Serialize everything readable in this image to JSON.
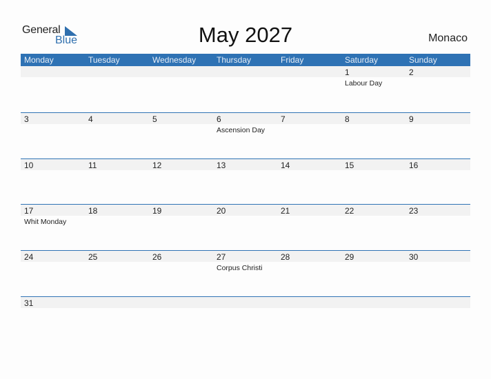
{
  "logo": {
    "general": "General",
    "blue": "Blue"
  },
  "title": "May 2027",
  "country": "Monaco",
  "colors": {
    "accent": "#2e72b4",
    "band": "#f2f2f2"
  },
  "weekdays": [
    "Monday",
    "Tuesday",
    "Wednesday",
    "Thursday",
    "Friday",
    "Saturday",
    "Sunday"
  ],
  "weeks": [
    [
      {
        "day": ""
      },
      {
        "day": ""
      },
      {
        "day": ""
      },
      {
        "day": ""
      },
      {
        "day": ""
      },
      {
        "day": "1",
        "holiday": "Labour Day"
      },
      {
        "day": "2"
      }
    ],
    [
      {
        "day": "3"
      },
      {
        "day": "4"
      },
      {
        "day": "5"
      },
      {
        "day": "6",
        "holiday": "Ascension Day"
      },
      {
        "day": "7"
      },
      {
        "day": "8"
      },
      {
        "day": "9"
      }
    ],
    [
      {
        "day": "10"
      },
      {
        "day": "11"
      },
      {
        "day": "12"
      },
      {
        "day": "13"
      },
      {
        "day": "14"
      },
      {
        "day": "15"
      },
      {
        "day": "16"
      }
    ],
    [
      {
        "day": "17",
        "holiday": "Whit Monday"
      },
      {
        "day": "18"
      },
      {
        "day": "19"
      },
      {
        "day": "20"
      },
      {
        "day": "21"
      },
      {
        "day": "22"
      },
      {
        "day": "23"
      }
    ],
    [
      {
        "day": "24"
      },
      {
        "day": "25"
      },
      {
        "day": "26"
      },
      {
        "day": "27",
        "holiday": "Corpus Christi"
      },
      {
        "day": "28"
      },
      {
        "day": "29"
      },
      {
        "day": "30"
      }
    ],
    [
      {
        "day": "31"
      },
      {
        "day": ""
      },
      {
        "day": ""
      },
      {
        "day": ""
      },
      {
        "day": ""
      },
      {
        "day": ""
      },
      {
        "day": ""
      }
    ]
  ]
}
